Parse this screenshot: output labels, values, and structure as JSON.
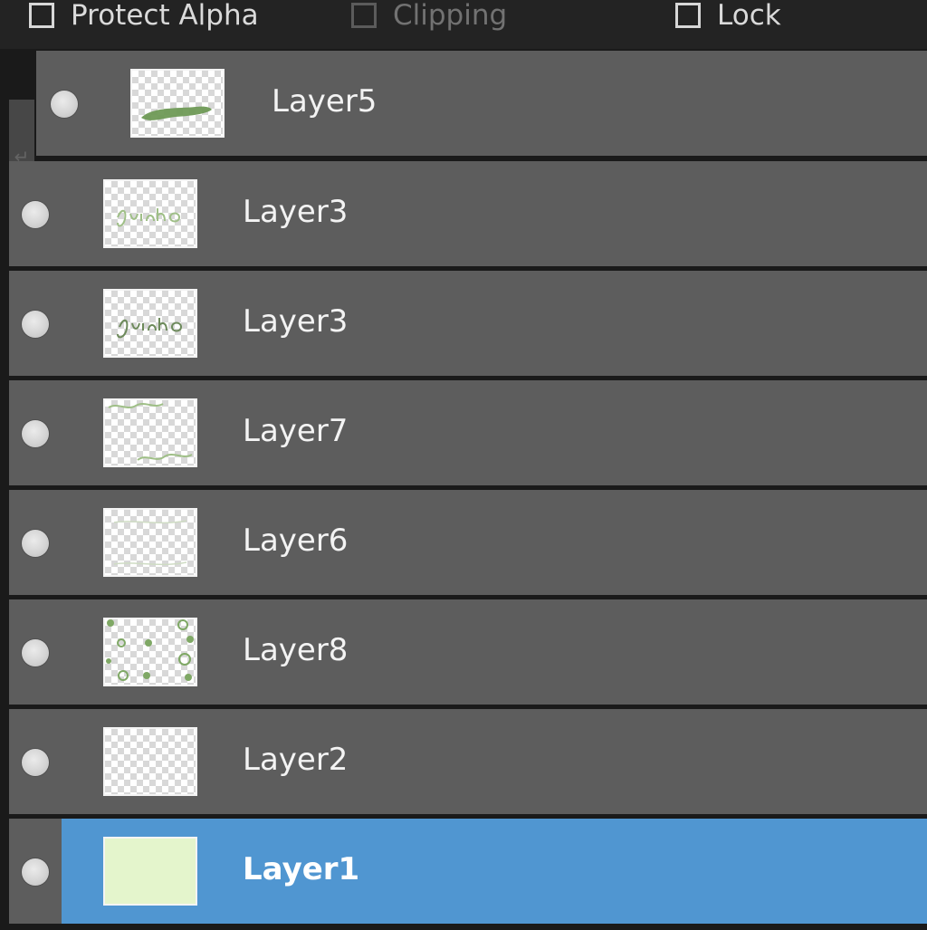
{
  "options": {
    "protect_alpha": {
      "label": "Protect Alpha",
      "checked": false,
      "enabled": true
    },
    "clipping": {
      "label": "Clipping",
      "checked": false,
      "enabled": false
    },
    "lock": {
      "label": "Lock",
      "checked": false,
      "enabled": true
    }
  },
  "layers": [
    {
      "name": "Layer5",
      "visible": true,
      "clipped": true,
      "selected": false,
      "thumbnail": "green-brush-stroke"
    },
    {
      "name": "Layer3",
      "visible": true,
      "clipped": false,
      "selected": false,
      "thumbnail": "handwriting-light"
    },
    {
      "name": "Layer3",
      "visible": true,
      "clipped": false,
      "selected": false,
      "thumbnail": "handwriting-dark"
    },
    {
      "name": "Layer7",
      "visible": true,
      "clipped": false,
      "selected": false,
      "thumbnail": "wavy-lines"
    },
    {
      "name": "Layer6",
      "visible": true,
      "clipped": false,
      "selected": false,
      "thumbnail": "faint-lines"
    },
    {
      "name": "Layer8",
      "visible": true,
      "clipped": false,
      "selected": false,
      "thumbnail": "green-dots"
    },
    {
      "name": "Layer2",
      "visible": true,
      "clipped": false,
      "selected": false,
      "thumbnail": "transparent"
    },
    {
      "name": "Layer1",
      "visible": true,
      "clipped": false,
      "selected": true,
      "thumbnail": "light-green-fill"
    }
  ],
  "colors": {
    "panel_bg": "#1f1f1f",
    "row_bg": "#5d5d5d",
    "selected_bg": "#5096d1",
    "thumbnail_green": "#6f9a56",
    "selected_thumb_fill": "#e4f5cc"
  }
}
